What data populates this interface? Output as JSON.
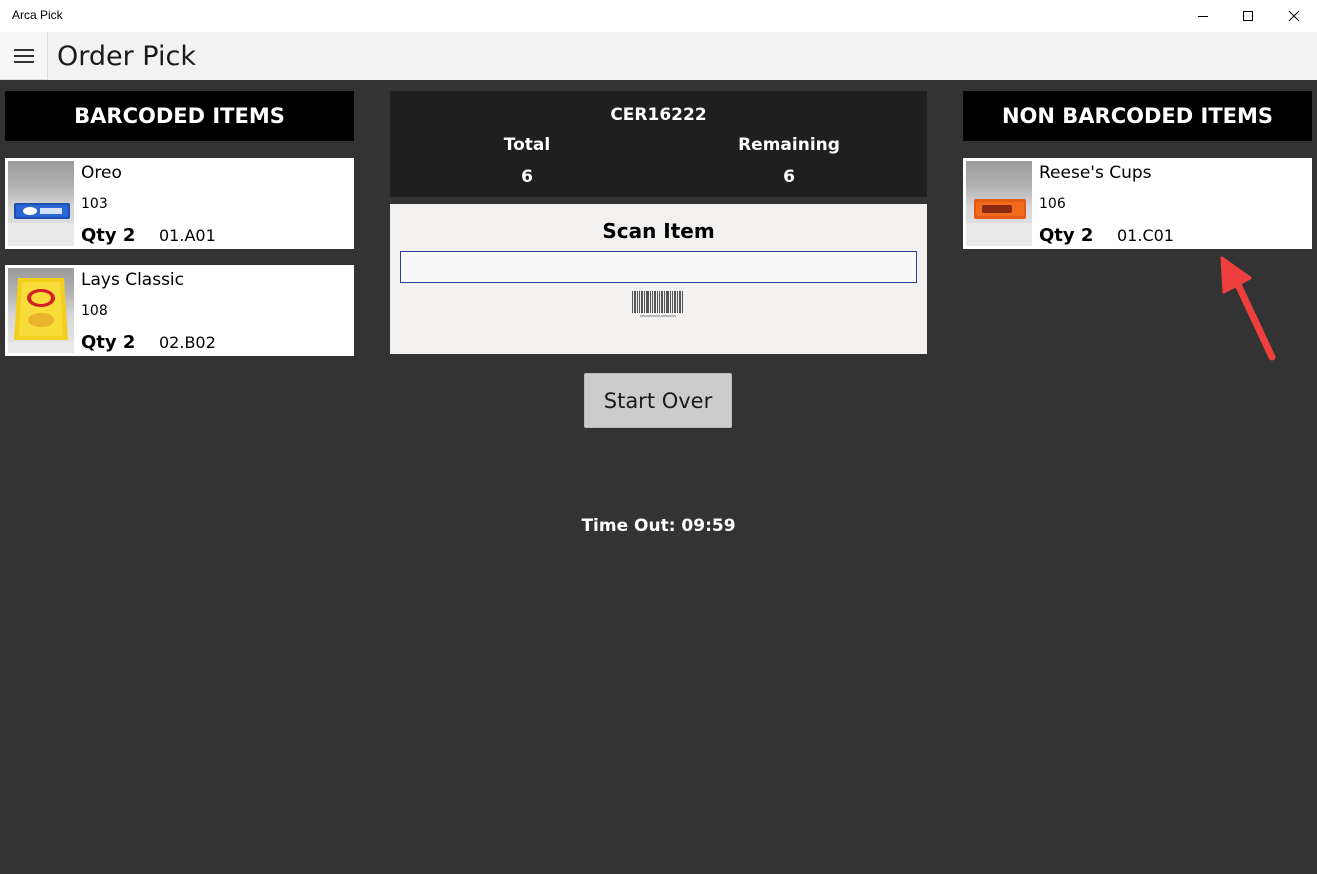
{
  "window": {
    "title": "Arca Pick",
    "minimize_icon": "minimize-icon",
    "maximize_icon": "maximize-icon",
    "close_icon": "close-icon"
  },
  "header": {
    "menu_icon": "hamburger-menu-icon",
    "title": "Order Pick"
  },
  "barcoded": {
    "heading": "BARCODED ITEMS",
    "items": [
      {
        "name": "Oreo",
        "code": "103",
        "qty": "Qty 2",
        "location": "01.A01",
        "image": "oreo-package-image"
      },
      {
        "name": "Lays Classic",
        "code": "108",
        "qty": "Qty 2",
        "location": "02.B02",
        "image": "lays-bag-image"
      }
    ]
  },
  "summary": {
    "order_id": "CER16222",
    "total_label": "Total",
    "total_value": "6",
    "remaining_label": "Remaining",
    "remaining_value": "6"
  },
  "scan": {
    "title": "Scan Item",
    "value": "",
    "placeholder": "",
    "barcode_icon": "barcode-icon"
  },
  "actions": {
    "start_over": "Start Over"
  },
  "timeout": {
    "text": "Time Out: 09:59"
  },
  "non_barcoded": {
    "heading": "NON BARCODED ITEMS",
    "items": [
      {
        "name": "Reese's Cups",
        "code": "106",
        "qty": "Qty 2",
        "location": "01.C01",
        "image": "reeses-package-image"
      }
    ]
  },
  "colors": {
    "background": "#333333",
    "header_black": "#000000",
    "summary_bg": "#1f1f1f",
    "annotation_arrow": "#ee3e3e"
  }
}
